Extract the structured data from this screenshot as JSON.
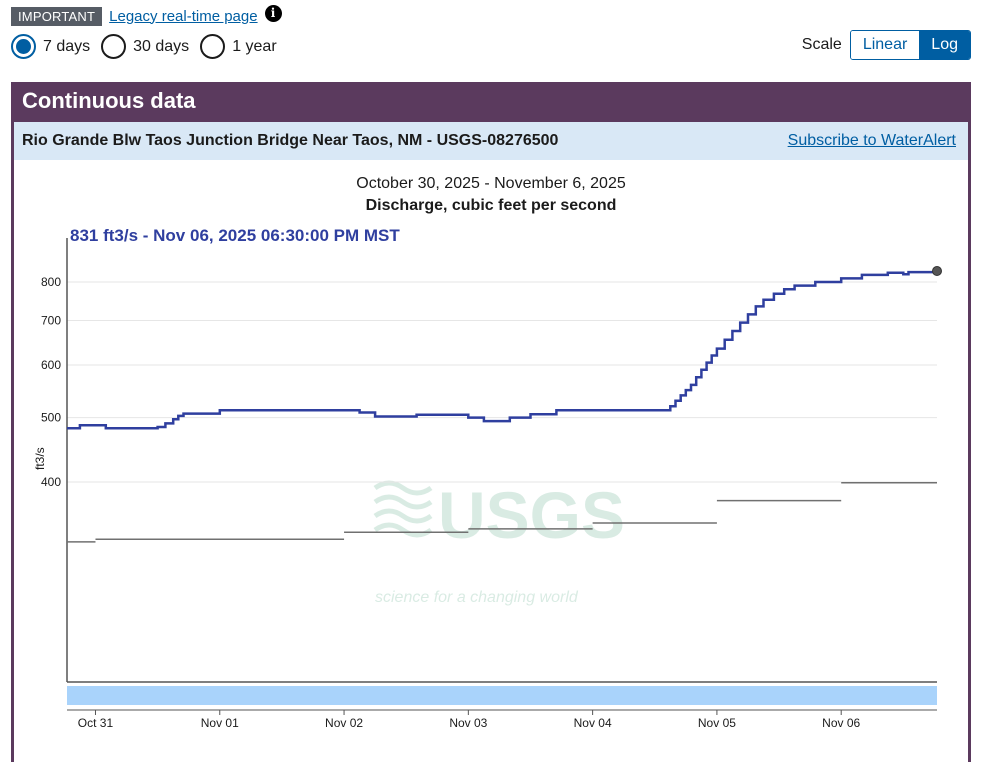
{
  "notice": {
    "badge": "IMPORTANT",
    "legacy_link": "Legacy real-time page",
    "info_icon": "info-icon"
  },
  "time_range": {
    "options": [
      {
        "label": "7 days",
        "selected": true
      },
      {
        "label": "30 days",
        "selected": false
      },
      {
        "label": "1 year",
        "selected": false
      }
    ]
  },
  "scale": {
    "label": "Scale",
    "options": [
      "Linear",
      "Log"
    ],
    "selected": "Log"
  },
  "panel": {
    "title": "Continuous data",
    "site_name": "Rio Grande Blw Taos Junction Bridge Near Taos, NM - USGS-08276500",
    "subscribe_link": "Subscribe to WaterAlert"
  },
  "colors": {
    "accent": "#005ea2",
    "panel": "#5b3a5e",
    "subbar": "#d9e8f6",
    "series": "#2f3f9f",
    "stats": "#707070",
    "approval_bar": "#a9d3fb"
  },
  "watermark": {
    "logo": "USGS",
    "tagline": "science for a changing world"
  },
  "chart_data": {
    "type": "line",
    "title": "October 30, 2025 - November 6, 2025",
    "subtitle": "Discharge, cubic feet per second",
    "latest_label": "831 ft3/s - Nov 06, 2025 06:30:00 PM MST",
    "ylabel": "ft3/s",
    "y_scale": "log",
    "ylim": [
      200,
      900
    ],
    "y_ticks": [
      400,
      500,
      600,
      700,
      800
    ],
    "x_start": "2025-10-30T18:30",
    "x_end": "2025-11-06T18:30",
    "x_ticks": [
      {
        "label": "Oct 31",
        "t": "2025-10-31T00:00"
      },
      {
        "label": "Nov 01",
        "t": "2025-11-01T00:00"
      },
      {
        "label": "Nov 02",
        "t": "2025-11-02T00:00"
      },
      {
        "label": "Nov 03",
        "t": "2025-11-03T00:00"
      },
      {
        "label": "Nov 04",
        "t": "2025-11-04T00:00"
      },
      {
        "label": "Nov 05",
        "t": "2025-11-05T00:00"
      },
      {
        "label": "Nov 06",
        "t": "2025-11-06T00:00"
      }
    ],
    "grid": true,
    "series": [
      {
        "style": "step",
        "points": [
          [
            "2025-10-30T18:30",
            482
          ],
          [
            "2025-10-30T21:00",
            487
          ],
          [
            "2025-10-31T02:00",
            482
          ],
          [
            "2025-10-31T12:00",
            484
          ],
          [
            "2025-10-31T13:30",
            490
          ],
          [
            "2025-10-31T15:00",
            497
          ],
          [
            "2025-10-31T16:00",
            503
          ],
          [
            "2025-10-31T17:00",
            507
          ],
          [
            "2025-11-01T00:00",
            513
          ],
          [
            "2025-11-02T00:00",
            513
          ],
          [
            "2025-11-02T03:00",
            509
          ],
          [
            "2025-11-02T06:00",
            502
          ],
          [
            "2025-11-02T14:00",
            505
          ],
          [
            "2025-11-03T00:00",
            500
          ],
          [
            "2025-11-03T03:00",
            494
          ],
          [
            "2025-11-03T08:00",
            500
          ],
          [
            "2025-11-03T12:00",
            506
          ],
          [
            "2025-11-03T17:00",
            513
          ],
          [
            "2025-11-04T14:00",
            513
          ],
          [
            "2025-11-04T15:00",
            520
          ],
          [
            "2025-11-04T16:00",
            530
          ],
          [
            "2025-11-04T17:00",
            540
          ],
          [
            "2025-11-04T18:00",
            550
          ],
          [
            "2025-11-04T19:00",
            560
          ],
          [
            "2025-11-04T20:00",
            575
          ],
          [
            "2025-11-04T21:00",
            590
          ],
          [
            "2025-11-04T22:00",
            605
          ],
          [
            "2025-11-04T23:00",
            620
          ],
          [
            "2025-11-05T00:00",
            635
          ],
          [
            "2025-11-05T01:30",
            655
          ],
          [
            "2025-11-05T03:00",
            675
          ],
          [
            "2025-11-05T04:30",
            695
          ],
          [
            "2025-11-05T06:00",
            715
          ],
          [
            "2025-11-05T07:30",
            735
          ],
          [
            "2025-11-05T09:00",
            752
          ],
          [
            "2025-11-05T11:00",
            768
          ],
          [
            "2025-11-05T13:00",
            780
          ],
          [
            "2025-11-05T15:00",
            790
          ],
          [
            "2025-11-05T19:00",
            800
          ],
          [
            "2025-11-06T00:00",
            810
          ],
          [
            "2025-11-06T04:00",
            820
          ],
          [
            "2025-11-06T09:00",
            826
          ],
          [
            "2025-11-06T12:00",
            822
          ],
          [
            "2025-11-06T13:00",
            828
          ],
          [
            "2025-11-06T18:30",
            831
          ]
        ]
      },
      {
        "style": "median-segments",
        "segments": [
          [
            "2025-10-30T18:30",
            "2025-10-31T00:00",
            325
          ],
          [
            "2025-10-31T00:00",
            "2025-11-02T00:00",
            328
          ],
          [
            "2025-11-02T00:00",
            "2025-11-03T00:00",
            336
          ],
          [
            "2025-11-03T00:00",
            "2025-11-04T00:00",
            340
          ],
          [
            "2025-11-04T00:00",
            "2025-11-05T00:00",
            347
          ],
          [
            "2025-11-05T00:00",
            "2025-11-06T00:00",
            375
          ],
          [
            "2025-11-06T00:00",
            "2025-11-06T18:30",
            399
          ]
        ]
      }
    ]
  }
}
